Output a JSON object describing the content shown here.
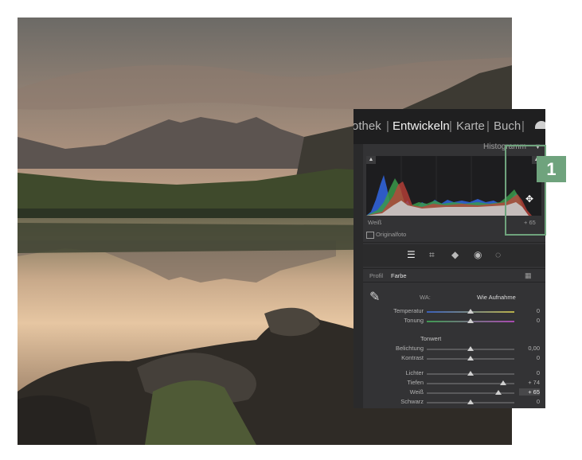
{
  "nav": {
    "items": [
      "othek",
      "Entwickeln",
      "Karte",
      "Buch"
    ],
    "active": "Entwickeln",
    "separator": "|"
  },
  "histogram": {
    "title": "Histogramm",
    "readout_label": "Weiß",
    "readout_value": "+ 65",
    "original_photo_label": "Originalfoto"
  },
  "basic": {
    "profile_label": "Profil",
    "profile_value": "Farbe",
    "wb_label": "WA:",
    "wb_value": "Wie Aufnahme",
    "tone_heading": "Tonwert",
    "sliders": [
      {
        "name": "temperatur",
        "label": "Temperatur",
        "value": "0",
        "level": 0.5
      },
      {
        "name": "tonung",
        "label": "Tonung",
        "value": "0",
        "level": 0.5
      },
      {
        "name": "belichtung",
        "label": "Belichtung",
        "value": "0,00",
        "level": 0.5
      },
      {
        "name": "kontrast",
        "label": "Kontrast",
        "value": "0",
        "level": 0.5
      },
      {
        "name": "lichter",
        "label": "Lichter",
        "value": "0",
        "level": 0.5
      },
      {
        "name": "tiefen",
        "label": "Tiefen",
        "value": "+ 74",
        "level": 0.87
      },
      {
        "name": "weiss",
        "label": "Weiß",
        "value": "+ 65",
        "level": 0.82
      },
      {
        "name": "schwarz",
        "label": "Schwarz",
        "value": "0",
        "level": 0.5
      }
    ]
  },
  "callout": {
    "number": "1"
  },
  "colors": {
    "callout": "#6fa37d",
    "panel": "#333335"
  },
  "icons": [
    "crosshair-move-icon",
    "eyedropper-icon",
    "edit-sliders-icon",
    "crop-icon",
    "eraser-icon",
    "redeye-icon",
    "masking-icon",
    "grid-icon"
  ]
}
